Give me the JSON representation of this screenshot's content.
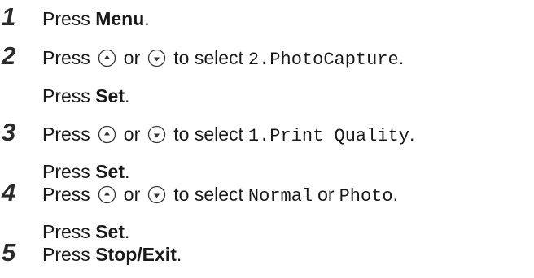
{
  "steps": [
    {
      "number": "1",
      "lines": [
        {
          "press": "Press ",
          "key": "Menu",
          "end": "."
        }
      ]
    },
    {
      "number": "2",
      "press": "Press",
      "up_icon": "up-arrow-button-icon",
      "or": "or",
      "down_icon": "down-arrow-button-icon",
      "to_select": "to select",
      "option": "2.PhotoCapture",
      "end": ".",
      "set_press": "Press ",
      "set_key": "Set",
      "set_end": "."
    },
    {
      "number": "3",
      "press": "Press",
      "up_icon": "up-arrow-button-icon",
      "or": "or",
      "down_icon": "down-arrow-button-icon",
      "to_select": "to select",
      "option": "1.Print Quality",
      "end": ".",
      "set_press": "Press ",
      "set_key": "Set",
      "set_end": "."
    },
    {
      "number": "4",
      "press": "Press",
      "up_icon": "up-arrow-button-icon",
      "or": "or",
      "down_icon": "down-arrow-button-icon",
      "to_select": "to select",
      "option_a": "Normal",
      "or2": "or",
      "option_b": "Photo",
      "end": ".",
      "set_press": "Press ",
      "set_key": "Set",
      "set_end": "."
    },
    {
      "number": "5",
      "lines": [
        {
          "press": "Press ",
          "key": "Stop/Exit",
          "end": "."
        }
      ]
    }
  ],
  "colors": {
    "text": "#1a1a1a",
    "icon_stroke": "#333333"
  }
}
